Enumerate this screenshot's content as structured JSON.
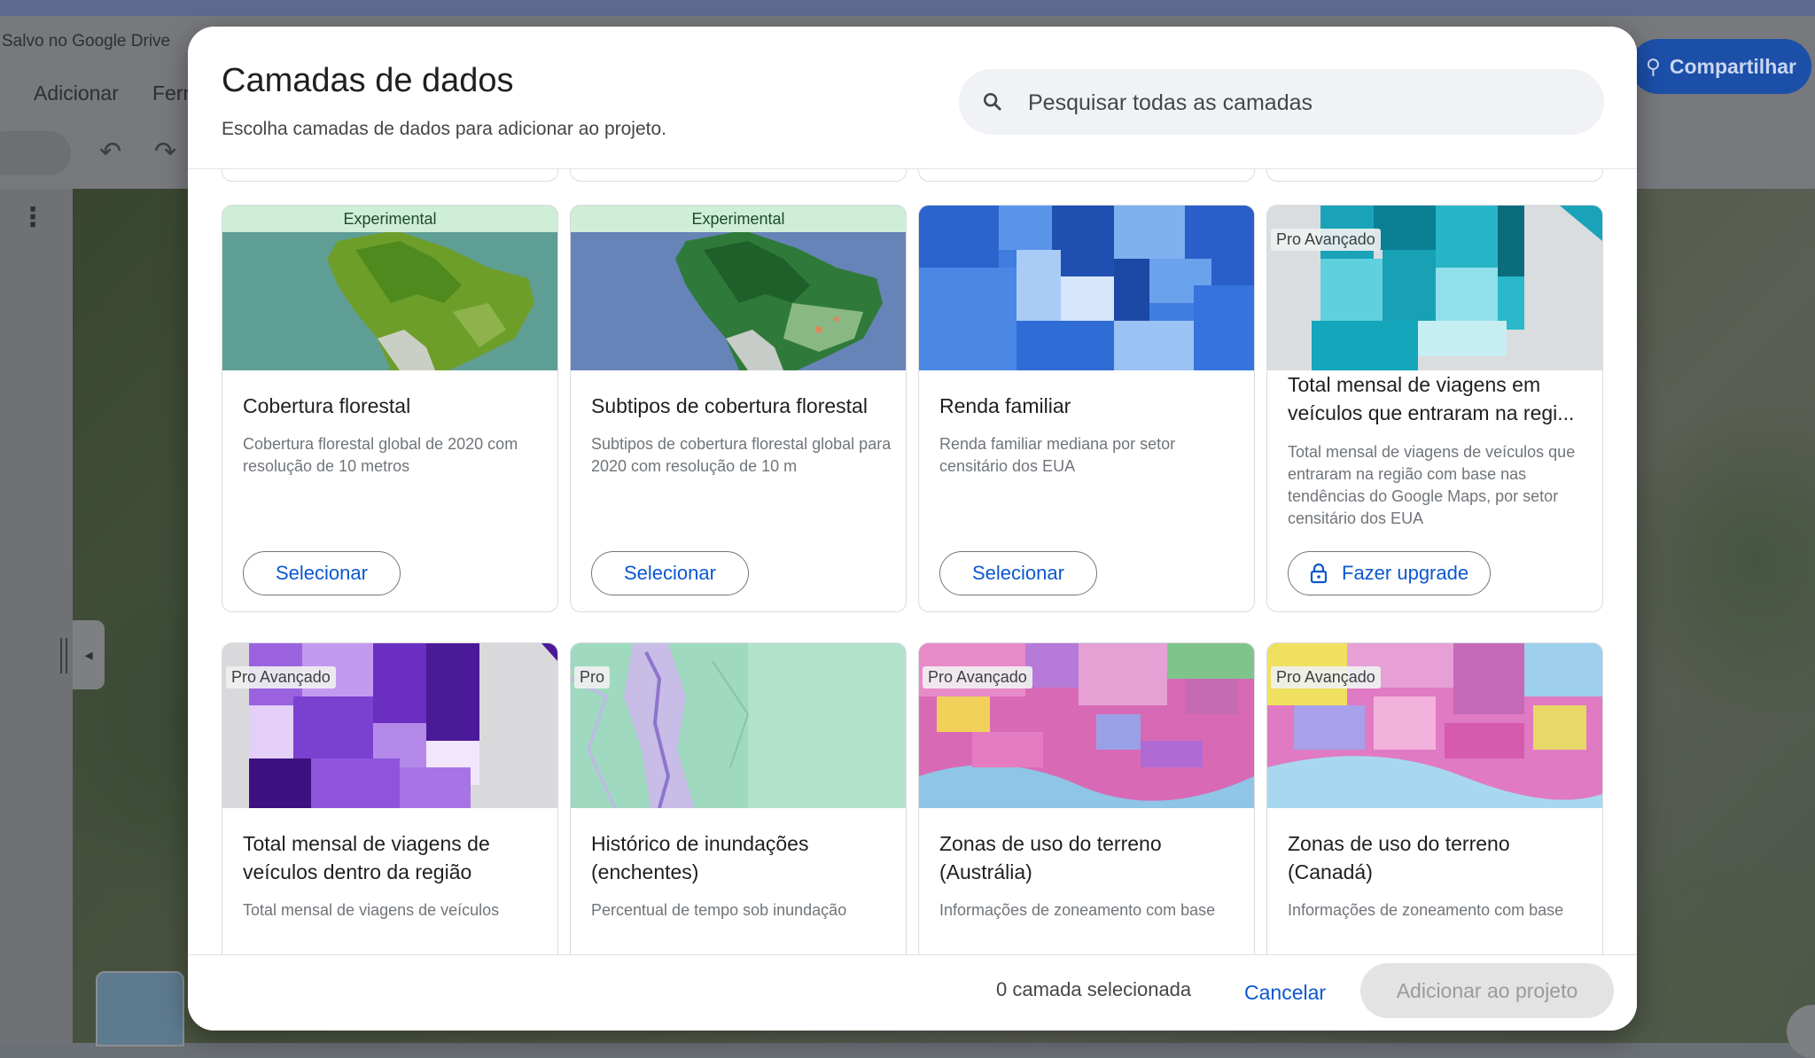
{
  "background_app": {
    "saved_status": "Salvo no Google Drive",
    "menu": [
      "Adicionar",
      "Ferr"
    ],
    "share_label": "Compartilhar"
  },
  "dialog": {
    "title": "Camadas de dados",
    "subtitle": "Escolha camadas de dados para adicionar ao projeto.",
    "search_placeholder": "Pesquisar todas as camadas"
  },
  "cards": [
    {
      "badge": "Experimental",
      "title": "Cobertura florestal",
      "description": "Cobertura florestal global de 2020 com resolução de 10 metros",
      "button": "Selecionar",
      "image": "forest-map"
    },
    {
      "badge": "Experimental",
      "title": "Subtipos de cobertura florestal",
      "description": "Subtipos de cobertura florestal global para 2020 com resolução de 10 m",
      "button": "Selecionar",
      "image": "forest-subtype-map"
    },
    {
      "badge": "",
      "title": "Renda familiar",
      "description": "Renda familiar mediana por setor censitário dos EUA",
      "button": "Selecionar",
      "image": "income-map"
    },
    {
      "badge": "Pro Avançado",
      "title": "Total mensal de viagens em veículos que entraram na regi...",
      "description": "Total mensal de viagens de veículos que entraram na região com base nas tendências do Google Maps, por setor censitário dos EUA",
      "button": "Fazer upgrade",
      "image": "trips-in-map"
    },
    {
      "badge": "Pro Avançado",
      "title": "Total mensal de viagens de veículos dentro da região",
      "description": "Total mensal de viagens de veículos",
      "image": "trips-within-map"
    },
    {
      "badge": "Pro",
      "title": "Histórico de inundações (enchentes)",
      "description": "Percentual de tempo sob inundação",
      "image": "flood-map"
    },
    {
      "badge": "Pro Avançado",
      "title": "Zonas de uso do terreno (Austrália)",
      "description": "Informações de zoneamento com base",
      "image": "zoning-au-map"
    },
    {
      "badge": "Pro Avançado",
      "title": "Zonas de uso do terreno (Canadá)",
      "description": "Informações de zoneamento com base",
      "image": "zoning-ca-map"
    }
  ],
  "footer": {
    "selected_count": "0 camada selecionada",
    "cancel_label": "Cancelar",
    "add_label": "Adicionar ao projeto"
  },
  "colors": {
    "primary": "#0b57d0",
    "experimental_badge": "#cfeed7",
    "disabled_button": "#e3e3e3"
  }
}
